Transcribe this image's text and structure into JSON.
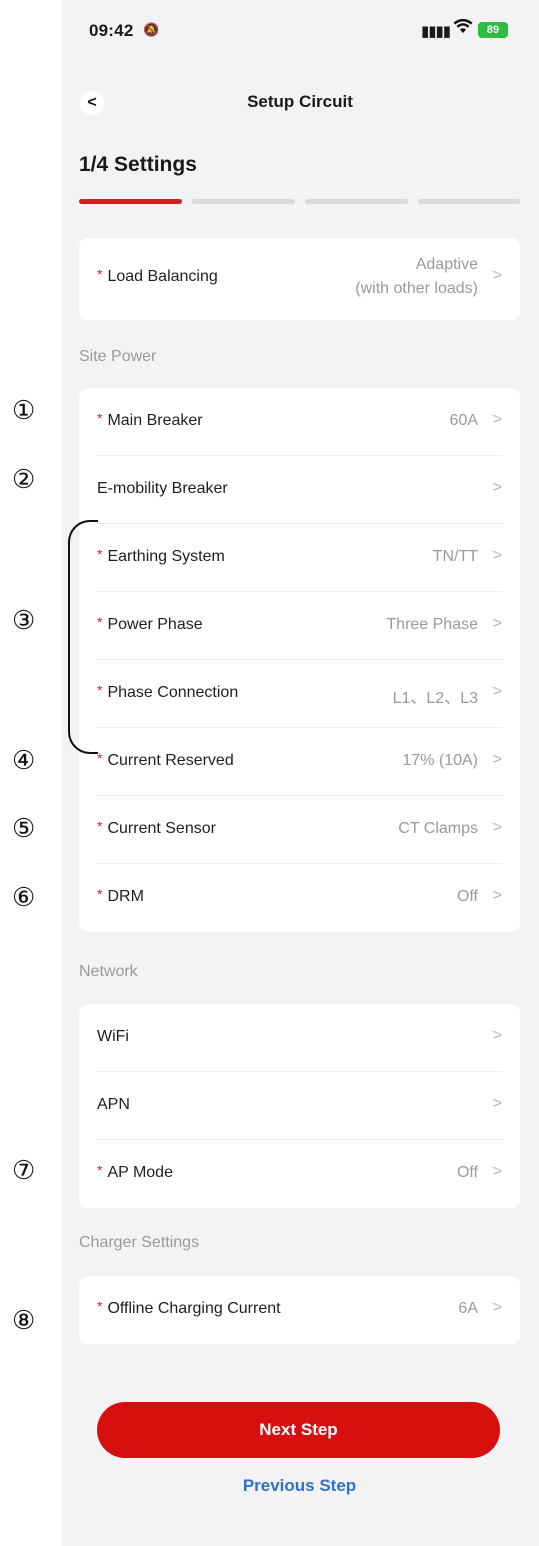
{
  "status_bar": {
    "time": "09:42",
    "battery": "89"
  },
  "nav": {
    "back_label": "<",
    "title": "Setup Circuit"
  },
  "step": {
    "title": "1/4 Settings",
    "current": 1,
    "total": 4
  },
  "load_balancing": {
    "label": "Load Balancing",
    "value_line1": "Adaptive",
    "value_line2": "(with other loads)",
    "required": true
  },
  "sections": {
    "site_power": "Site Power",
    "network": "Network",
    "charger_settings": "Charger Settings"
  },
  "site_power_rows": [
    {
      "label": "Main Breaker",
      "value": "60A",
      "required": true
    },
    {
      "label": "E-mobility Breaker",
      "value": "",
      "required": false
    },
    {
      "label": "Earthing System",
      "value": "TN/TT",
      "required": true
    },
    {
      "label": "Power Phase",
      "value": "Three Phase",
      "required": true
    },
    {
      "label": "Phase Connection",
      "value": "L1、L2、L3",
      "required": true
    },
    {
      "label": "Current Reserved",
      "value": "17% (10A)",
      "required": true
    },
    {
      "label": "Current Sensor",
      "value": "CT Clamps",
      "required": true
    },
    {
      "label": "DRM",
      "value": "Off",
      "required": true
    }
  ],
  "network_rows": [
    {
      "label": "WiFi",
      "value": "",
      "required": false
    },
    {
      "label": "APN",
      "value": "",
      "required": false
    },
    {
      "label": "AP Mode",
      "value": "Off",
      "required": true
    }
  ],
  "charger_rows": [
    {
      "label": "Offline Charging Current",
      "value": "6A",
      "required": true
    }
  ],
  "markers": [
    "①",
    "②",
    "③",
    "④",
    "⑤",
    "⑥",
    "⑦",
    "⑧"
  ],
  "required_mark": "*",
  "buttons": {
    "next": "Next Step",
    "previous": "Previous Step"
  },
  "colors": {
    "accent": "#d80f0f",
    "link": "#2f72c8",
    "background": "#f3f3f5"
  }
}
